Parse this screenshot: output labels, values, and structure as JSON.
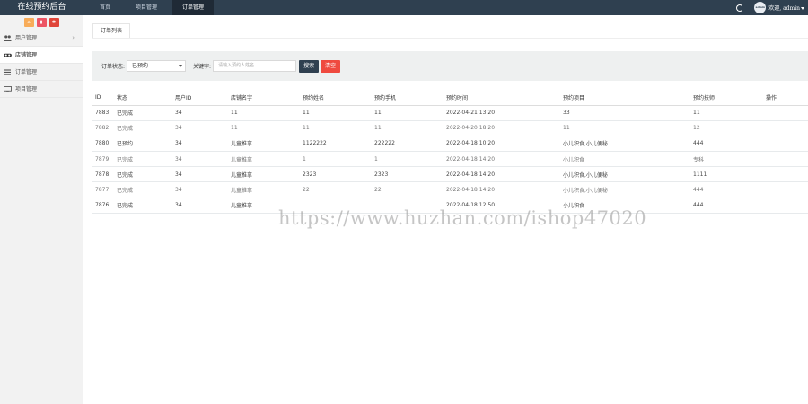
{
  "app": {
    "title": "在线预约后台"
  },
  "nav": {
    "items": [
      {
        "label": "首页"
      },
      {
        "label": "项目管理"
      },
      {
        "label": "订单管理"
      }
    ]
  },
  "user": {
    "avatar_text": "admin",
    "welcome": "欢迎, admin"
  },
  "sidebar": {
    "quick_buttons": [
      {
        "icon": "home-icon",
        "color": "#f8ac59"
      },
      {
        "icon": "trash-icon",
        "color": "#ed5565"
      },
      {
        "icon": "gear-icon",
        "color": "#e0463a"
      }
    ],
    "items": [
      {
        "label": "用户管理"
      },
      {
        "label": "店铺管理"
      },
      {
        "label": "订单管理"
      },
      {
        "label": "项目管理"
      }
    ]
  },
  "tab": {
    "label": "订单列表"
  },
  "filter": {
    "status_label": "订单状态:",
    "status_value": "已预约",
    "keyword_label": "关键字:",
    "keyword_placeholder": "请输入预约人姓名",
    "search_button": "搜索",
    "clear_button": "清空"
  },
  "table": {
    "headers": [
      "ID",
      "状态",
      "用户ID",
      "店铺名字",
      "预约姓名",
      "预约手机",
      "预约时间",
      "预约项目",
      "预约技师",
      "操作"
    ],
    "rows": [
      [
        "7883",
        "已完成",
        "34",
        "11",
        "11",
        "11",
        "2022-04-21 13:20",
        "33",
        "11",
        ""
      ],
      [
        "7882",
        "已完成",
        "34",
        "11",
        "11",
        "11",
        "2022-04-20 18:20",
        "11",
        "12",
        ""
      ],
      [
        "7880",
        "已预约",
        "34",
        "儿童推拿",
        "1122222",
        "222222",
        "2022-04-18 10:20",
        "小儿积食,小儿便秘",
        "444",
        ""
      ],
      [
        "7879",
        "已完成",
        "34",
        "儿童推拿",
        "1",
        "1",
        "2022-04-18 14:20",
        "小儿积食",
        "专科",
        ""
      ],
      [
        "7878",
        "已完成",
        "34",
        "儿童推拿",
        "2323",
        "2323",
        "2022-04-18 14:20",
        "小儿积食,小儿便秘",
        "1111",
        ""
      ],
      [
        "7877",
        "已完成",
        "34",
        "儿童推拿",
        "22",
        "22",
        "2022-04-18 14:20",
        "小儿积食,小儿便秘",
        "444",
        ""
      ],
      [
        "7876",
        "已完成",
        "34",
        "儿童推拿",
        "",
        "",
        "2022-04-18 12:50",
        "小儿积食",
        "444",
        ""
      ]
    ]
  },
  "watermark": {
    "text": "https://www.huzhan.com/ishop47020"
  },
  "colors": {
    "header_bg": "#2f4050",
    "accent_orange": "#f8ac59",
    "danger_red": "#ef4a3f"
  }
}
